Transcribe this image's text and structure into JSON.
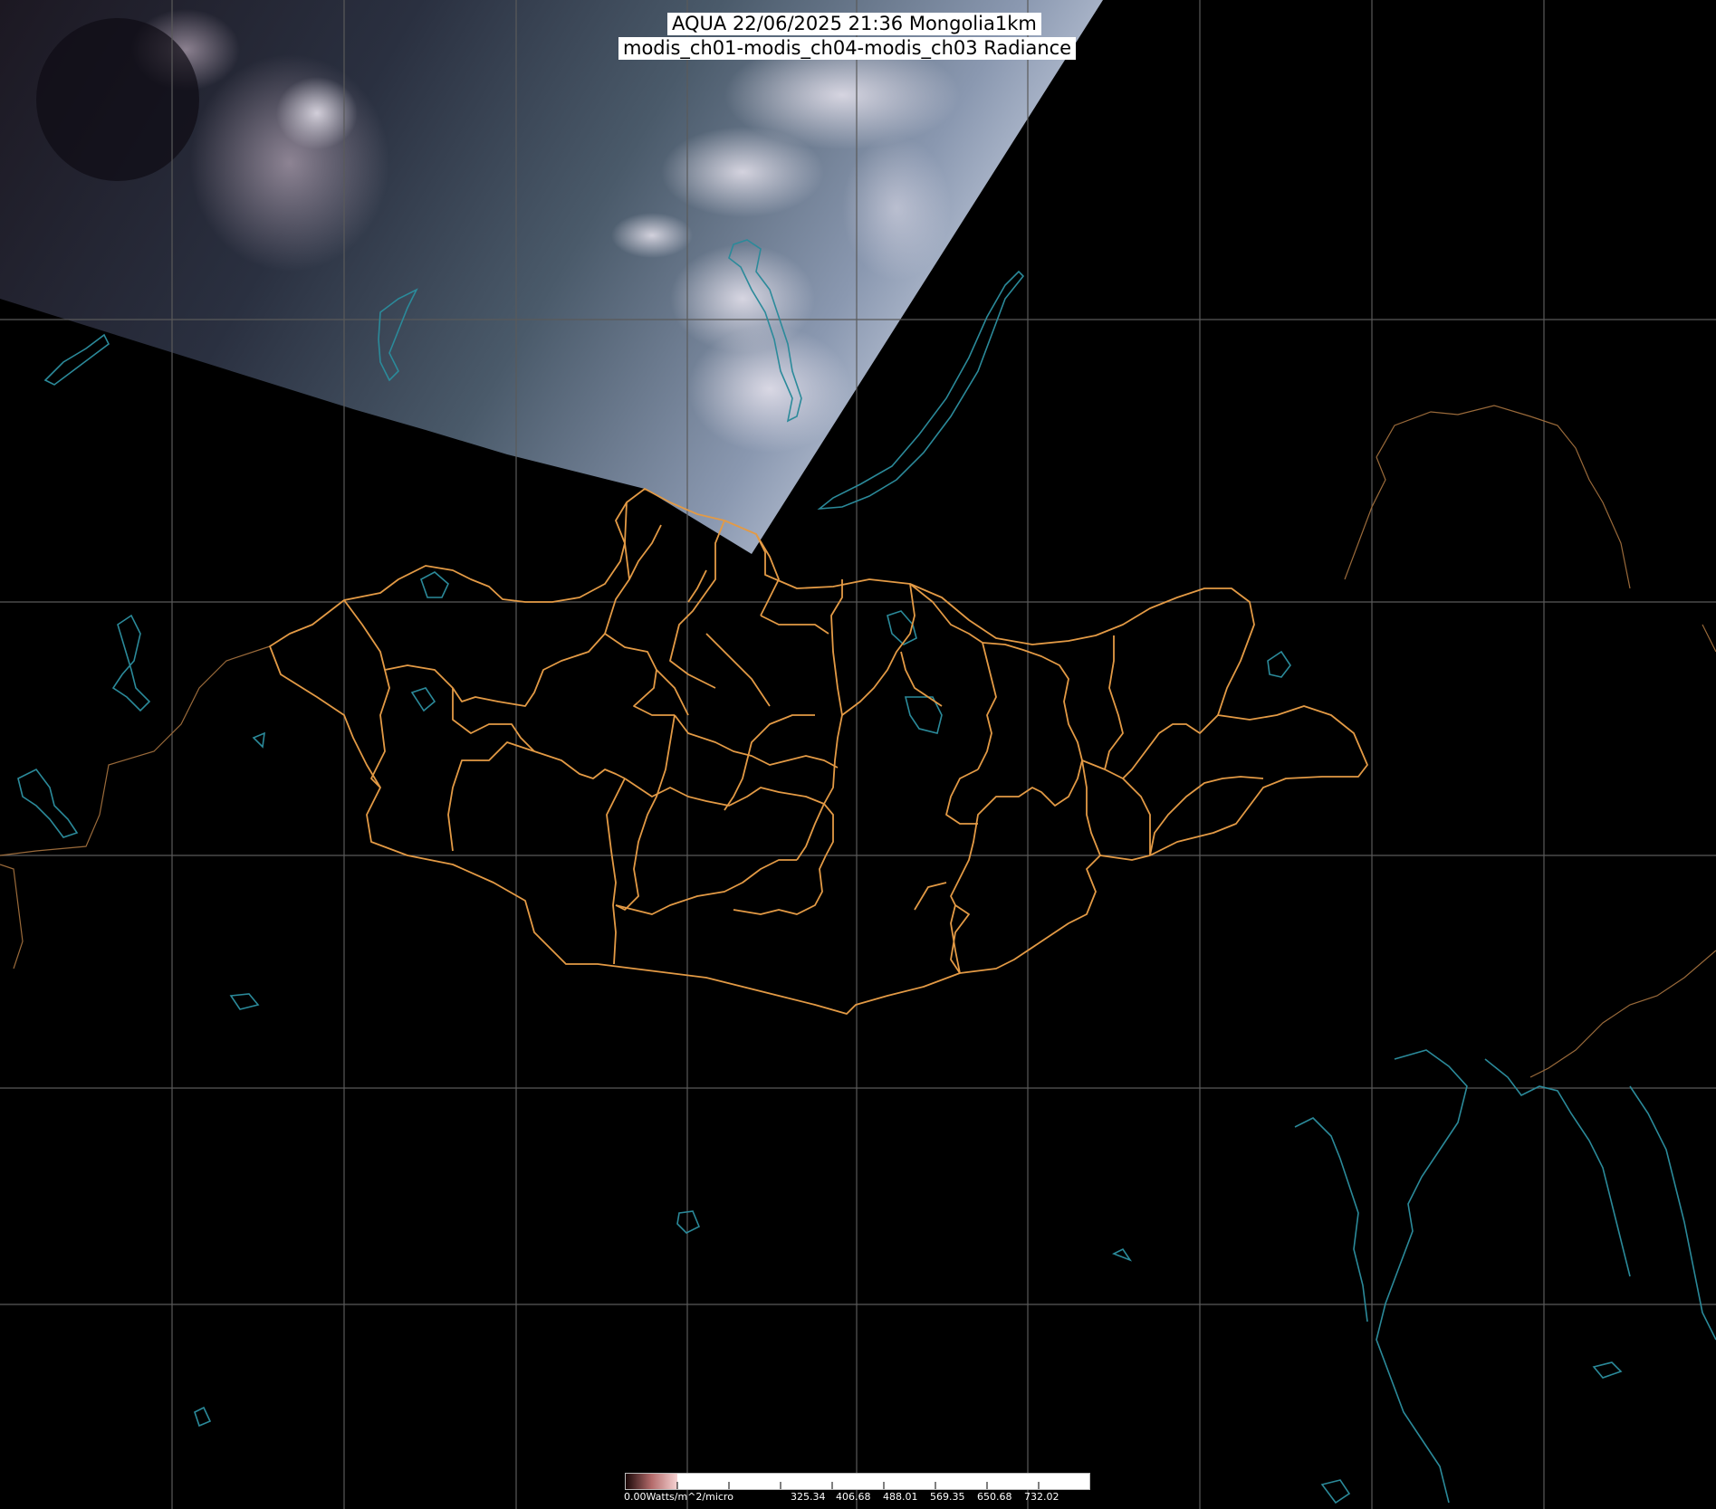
{
  "title": {
    "line1": "AQUA 22/06/2025 21:36 Mongolia1km",
    "line2": "modis_ch01-modis_ch04-modis_ch03 Radiance"
  },
  "colorbar": {
    "unit_label": "0.00Watts/m^2/micro",
    "ticks": [
      "325.34",
      "406.68",
      "488.01",
      "569.35",
      "650.68",
      "732.02"
    ]
  },
  "colors": {
    "background": "#000000",
    "graticule": "#5a5a5a",
    "mongolia_boundaries": "#e39a45",
    "coastlines_lakes": "#2b8a9a",
    "neighbor_borders": "#9a6a3a"
  }
}
